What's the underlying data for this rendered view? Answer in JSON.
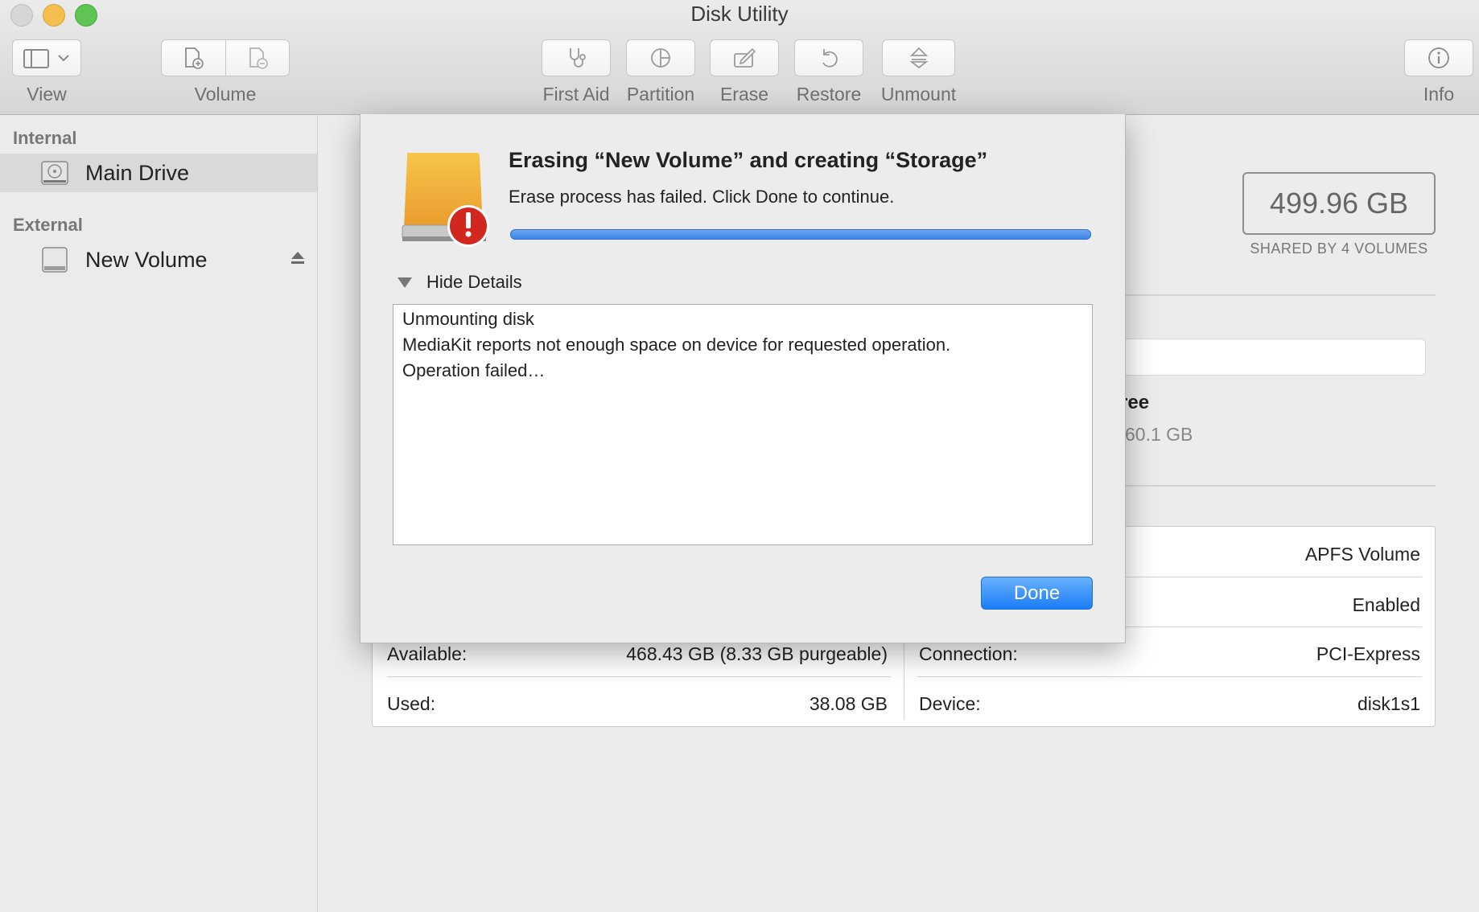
{
  "window": {
    "title": "Disk Utility",
    "traffic_colors": {
      "close": "#d6d6d6",
      "minimize": "#f5bf4f",
      "maximize": "#5fc454"
    }
  },
  "toolbar": {
    "view": "View",
    "volume": "Volume",
    "first_aid": "First Aid",
    "partition": "Partition",
    "erase": "Erase",
    "restore": "Restore",
    "unmount": "Unmount",
    "info": "Info",
    "icons": [
      "sidebar-toggle-icon",
      "add-volume-icon",
      "remove-volume-icon",
      "stethoscope-icon",
      "pie-icon",
      "pencil-icon",
      "restore-arrow-icon",
      "eject-icon",
      "info-icon"
    ]
  },
  "sidebar": {
    "internal_heading": "Internal",
    "external_heading": "External",
    "items": [
      {
        "label": "Main Drive",
        "icon": "hard-drive-icon",
        "selected": true
      },
      {
        "label": "New Volume",
        "icon": "external-drive-icon",
        "selected": false
      }
    ]
  },
  "main": {
    "capacity": "499.96 GB",
    "capacity_sub": "SHARED BY 4 VOLUMES",
    "free_label_partial": "ree",
    "free_value_partial": "60.1 GB",
    "info": {
      "type_value": "APFS Volume",
      "owners_value": "Enabled",
      "available_label": "Available:",
      "available_value": "468.43 GB (8.33 GB purgeable)",
      "used_label": "Used:",
      "used_value": "38.08 GB",
      "connection_label": "Connection:",
      "connection_value": "PCI-Express",
      "device_label": "Device:",
      "device_value": "disk1s1"
    }
  },
  "dialog": {
    "title": "Erasing “New Volume” and creating “Storage”",
    "message": "Erase process has failed. Click Done to continue.",
    "progress": 1.0,
    "disclosure": "Hide Details",
    "details": [
      "Unmounting disk",
      "MediaKit reports not enough space on device for requested operation.",
      "Operation failed…"
    ],
    "done": "Done",
    "accent": "#1a7cf5",
    "alert_color": "#d0281f",
    "drive_color": "#f2b43a"
  }
}
